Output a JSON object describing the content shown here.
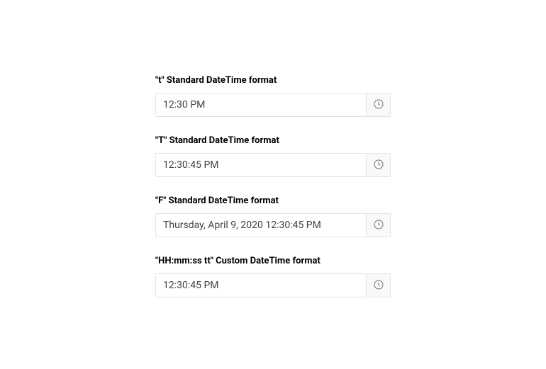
{
  "fields": [
    {
      "label": "\"t\" Standard DateTime format",
      "value": "12:30 PM"
    },
    {
      "label": "\"T\" Standard DateTime format",
      "value": "12:30:45 PM"
    },
    {
      "label": "\"F\" Standard DateTime format",
      "value": "Thursday, April 9, 2020 12:30:45 PM"
    },
    {
      "label": "\"HH:mm:ss tt\" Custom DateTime format",
      "value": "12:30:45 PM"
    }
  ]
}
